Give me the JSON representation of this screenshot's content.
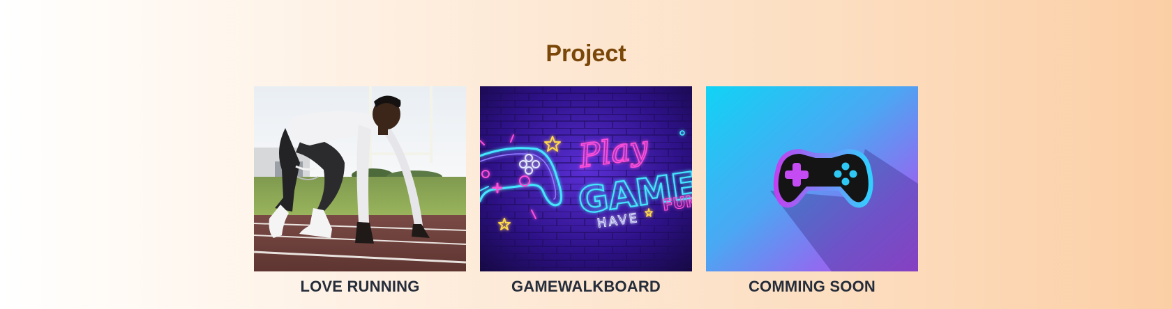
{
  "section": {
    "title": "Project"
  },
  "projects": [
    {
      "label": "LOVE RUNNING",
      "image_icon": "runner-photo"
    },
    {
      "label": "GAMEWALKBOARD",
      "image_icon": "neon-play-games-sign",
      "sign_lines": [
        "Play",
        "GAMES",
        "HAVE",
        "FUN"
      ]
    },
    {
      "label": "COMMING SOON",
      "image_icon": "gamepad-icon"
    }
  ],
  "colors": {
    "title": "#7a4708",
    "label": "#262d3a",
    "neon_pink": "#ff4fd8",
    "neon_cyan": "#44e6ff"
  }
}
